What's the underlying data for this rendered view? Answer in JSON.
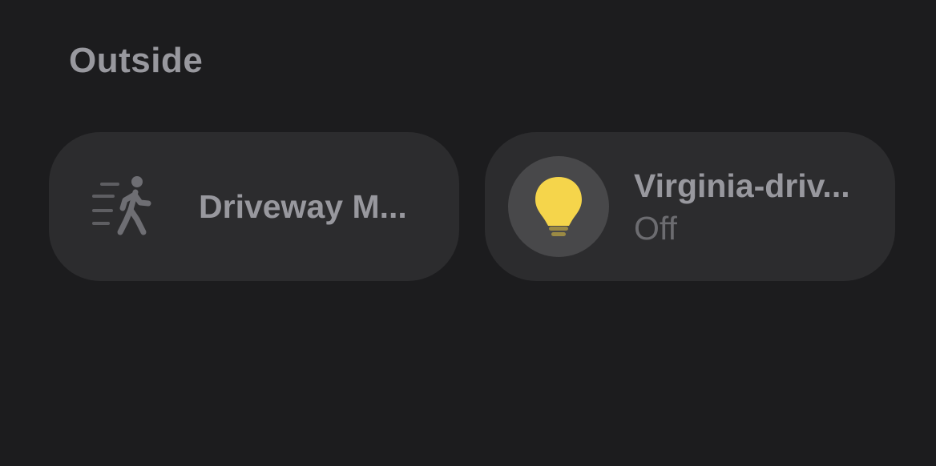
{
  "section": {
    "title": "Outside"
  },
  "accessories": [
    {
      "name": "Driveway M...",
      "icon": "motion-sensor-walking-person-icon"
    },
    {
      "name": "Virginia-driv...",
      "status": "Off",
      "icon": "lightbulb-icon",
      "icon_color": "#f5d54b"
    }
  ]
}
